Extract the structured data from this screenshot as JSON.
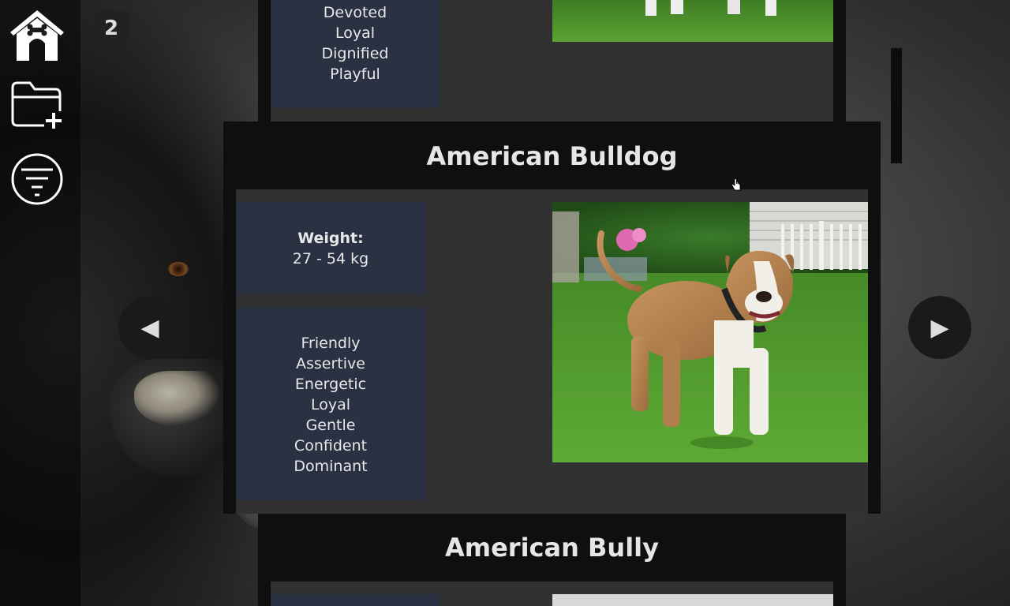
{
  "app": {
    "result_count": "2"
  },
  "sidebar": {
    "home_icon": "doghouse-icon",
    "add_folder_icon": "folder-plus-icon",
    "filter_icon": "filter-icon"
  },
  "nav": {
    "prev_label": "◀",
    "next_label": "▶"
  },
  "cards": {
    "previous": {
      "traits": [
        "Devoted",
        "Loyal",
        "Dignified",
        "Playful"
      ]
    },
    "current": {
      "name": "American Bulldog",
      "weight_label": "Weight:",
      "weight_value": "27 - 54 kg",
      "traits": [
        "Friendly",
        "Assertive",
        "Energetic",
        "Loyal",
        "Gentle",
        "Confident",
        "Dominant"
      ]
    },
    "next": {
      "name": "American Bully"
    }
  },
  "colors": {
    "info_box": "#2a3142",
    "card": "#0f0f0f",
    "grass": "#4f9a2e"
  }
}
